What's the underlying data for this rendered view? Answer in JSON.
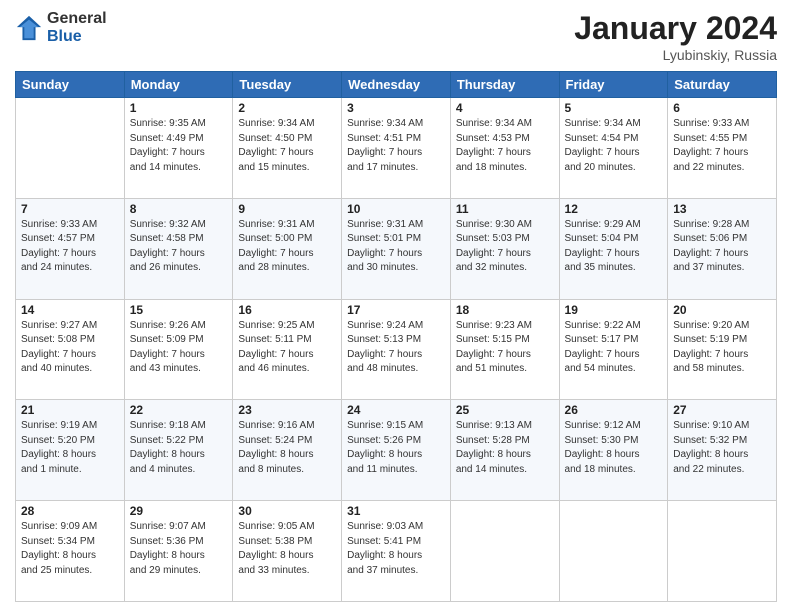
{
  "header": {
    "logo_general": "General",
    "logo_blue": "Blue",
    "title": "January 2024",
    "location": "Lyubinskiy, Russia"
  },
  "days_of_week": [
    "Sunday",
    "Monday",
    "Tuesday",
    "Wednesday",
    "Thursday",
    "Friday",
    "Saturday"
  ],
  "weeks": [
    [
      {
        "day": "",
        "info": ""
      },
      {
        "day": "1",
        "info": "Sunrise: 9:35 AM\nSunset: 4:49 PM\nDaylight: 7 hours\nand 14 minutes."
      },
      {
        "day": "2",
        "info": "Sunrise: 9:34 AM\nSunset: 4:50 PM\nDaylight: 7 hours\nand 15 minutes."
      },
      {
        "day": "3",
        "info": "Sunrise: 9:34 AM\nSunset: 4:51 PM\nDaylight: 7 hours\nand 17 minutes."
      },
      {
        "day": "4",
        "info": "Sunrise: 9:34 AM\nSunset: 4:53 PM\nDaylight: 7 hours\nand 18 minutes."
      },
      {
        "day": "5",
        "info": "Sunrise: 9:34 AM\nSunset: 4:54 PM\nDaylight: 7 hours\nand 20 minutes."
      },
      {
        "day": "6",
        "info": "Sunrise: 9:33 AM\nSunset: 4:55 PM\nDaylight: 7 hours\nand 22 minutes."
      }
    ],
    [
      {
        "day": "7",
        "info": "Sunrise: 9:33 AM\nSunset: 4:57 PM\nDaylight: 7 hours\nand 24 minutes."
      },
      {
        "day": "8",
        "info": "Sunrise: 9:32 AM\nSunset: 4:58 PM\nDaylight: 7 hours\nand 26 minutes."
      },
      {
        "day": "9",
        "info": "Sunrise: 9:31 AM\nSunset: 5:00 PM\nDaylight: 7 hours\nand 28 minutes."
      },
      {
        "day": "10",
        "info": "Sunrise: 9:31 AM\nSunset: 5:01 PM\nDaylight: 7 hours\nand 30 minutes."
      },
      {
        "day": "11",
        "info": "Sunrise: 9:30 AM\nSunset: 5:03 PM\nDaylight: 7 hours\nand 32 minutes."
      },
      {
        "day": "12",
        "info": "Sunrise: 9:29 AM\nSunset: 5:04 PM\nDaylight: 7 hours\nand 35 minutes."
      },
      {
        "day": "13",
        "info": "Sunrise: 9:28 AM\nSunset: 5:06 PM\nDaylight: 7 hours\nand 37 minutes."
      }
    ],
    [
      {
        "day": "14",
        "info": "Sunrise: 9:27 AM\nSunset: 5:08 PM\nDaylight: 7 hours\nand 40 minutes."
      },
      {
        "day": "15",
        "info": "Sunrise: 9:26 AM\nSunset: 5:09 PM\nDaylight: 7 hours\nand 43 minutes."
      },
      {
        "day": "16",
        "info": "Sunrise: 9:25 AM\nSunset: 5:11 PM\nDaylight: 7 hours\nand 46 minutes."
      },
      {
        "day": "17",
        "info": "Sunrise: 9:24 AM\nSunset: 5:13 PM\nDaylight: 7 hours\nand 48 minutes."
      },
      {
        "day": "18",
        "info": "Sunrise: 9:23 AM\nSunset: 5:15 PM\nDaylight: 7 hours\nand 51 minutes."
      },
      {
        "day": "19",
        "info": "Sunrise: 9:22 AM\nSunset: 5:17 PM\nDaylight: 7 hours\nand 54 minutes."
      },
      {
        "day": "20",
        "info": "Sunrise: 9:20 AM\nSunset: 5:19 PM\nDaylight: 7 hours\nand 58 minutes."
      }
    ],
    [
      {
        "day": "21",
        "info": "Sunrise: 9:19 AM\nSunset: 5:20 PM\nDaylight: 8 hours\nand 1 minute."
      },
      {
        "day": "22",
        "info": "Sunrise: 9:18 AM\nSunset: 5:22 PM\nDaylight: 8 hours\nand 4 minutes."
      },
      {
        "day": "23",
        "info": "Sunrise: 9:16 AM\nSunset: 5:24 PM\nDaylight: 8 hours\nand 8 minutes."
      },
      {
        "day": "24",
        "info": "Sunrise: 9:15 AM\nSunset: 5:26 PM\nDaylight: 8 hours\nand 11 minutes."
      },
      {
        "day": "25",
        "info": "Sunrise: 9:13 AM\nSunset: 5:28 PM\nDaylight: 8 hours\nand 14 minutes."
      },
      {
        "day": "26",
        "info": "Sunrise: 9:12 AM\nSunset: 5:30 PM\nDaylight: 8 hours\nand 18 minutes."
      },
      {
        "day": "27",
        "info": "Sunrise: 9:10 AM\nSunset: 5:32 PM\nDaylight: 8 hours\nand 22 minutes."
      }
    ],
    [
      {
        "day": "28",
        "info": "Sunrise: 9:09 AM\nSunset: 5:34 PM\nDaylight: 8 hours\nand 25 minutes."
      },
      {
        "day": "29",
        "info": "Sunrise: 9:07 AM\nSunset: 5:36 PM\nDaylight: 8 hours\nand 29 minutes."
      },
      {
        "day": "30",
        "info": "Sunrise: 9:05 AM\nSunset: 5:38 PM\nDaylight: 8 hours\nand 33 minutes."
      },
      {
        "day": "31",
        "info": "Sunrise: 9:03 AM\nSunset: 5:41 PM\nDaylight: 8 hours\nand 37 minutes."
      },
      {
        "day": "",
        "info": ""
      },
      {
        "day": "",
        "info": ""
      },
      {
        "day": "",
        "info": ""
      }
    ]
  ]
}
